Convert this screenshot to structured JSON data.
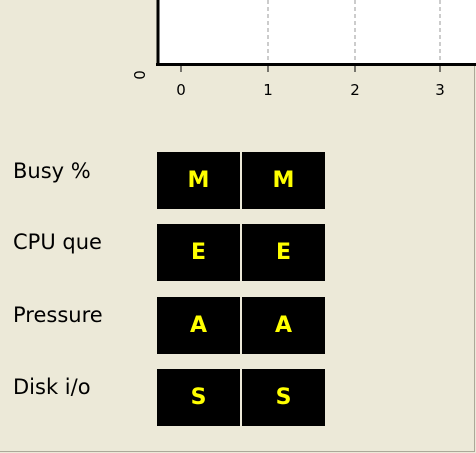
{
  "chart_data": {
    "type": "line",
    "x_ticks": [
      "0",
      "1",
      "2",
      "3"
    ],
    "y_ticks": [
      "0"
    ],
    "grid": true,
    "series": []
  },
  "grid": {
    "rows": [
      {
        "label": "Busy %",
        "cells": [
          "M",
          "M"
        ]
      },
      {
        "label": "CPU que",
        "cells": [
          "E",
          "E"
        ]
      },
      {
        "label": "Pressure",
        "cells": [
          "A",
          "A"
        ]
      },
      {
        "label": "Disk i/o",
        "cells": [
          "S",
          "S"
        ]
      }
    ],
    "colors": {
      "cell_bg": "#000000",
      "cell_text": "#ffff00",
      "window_bg": "#ece9d8"
    }
  }
}
